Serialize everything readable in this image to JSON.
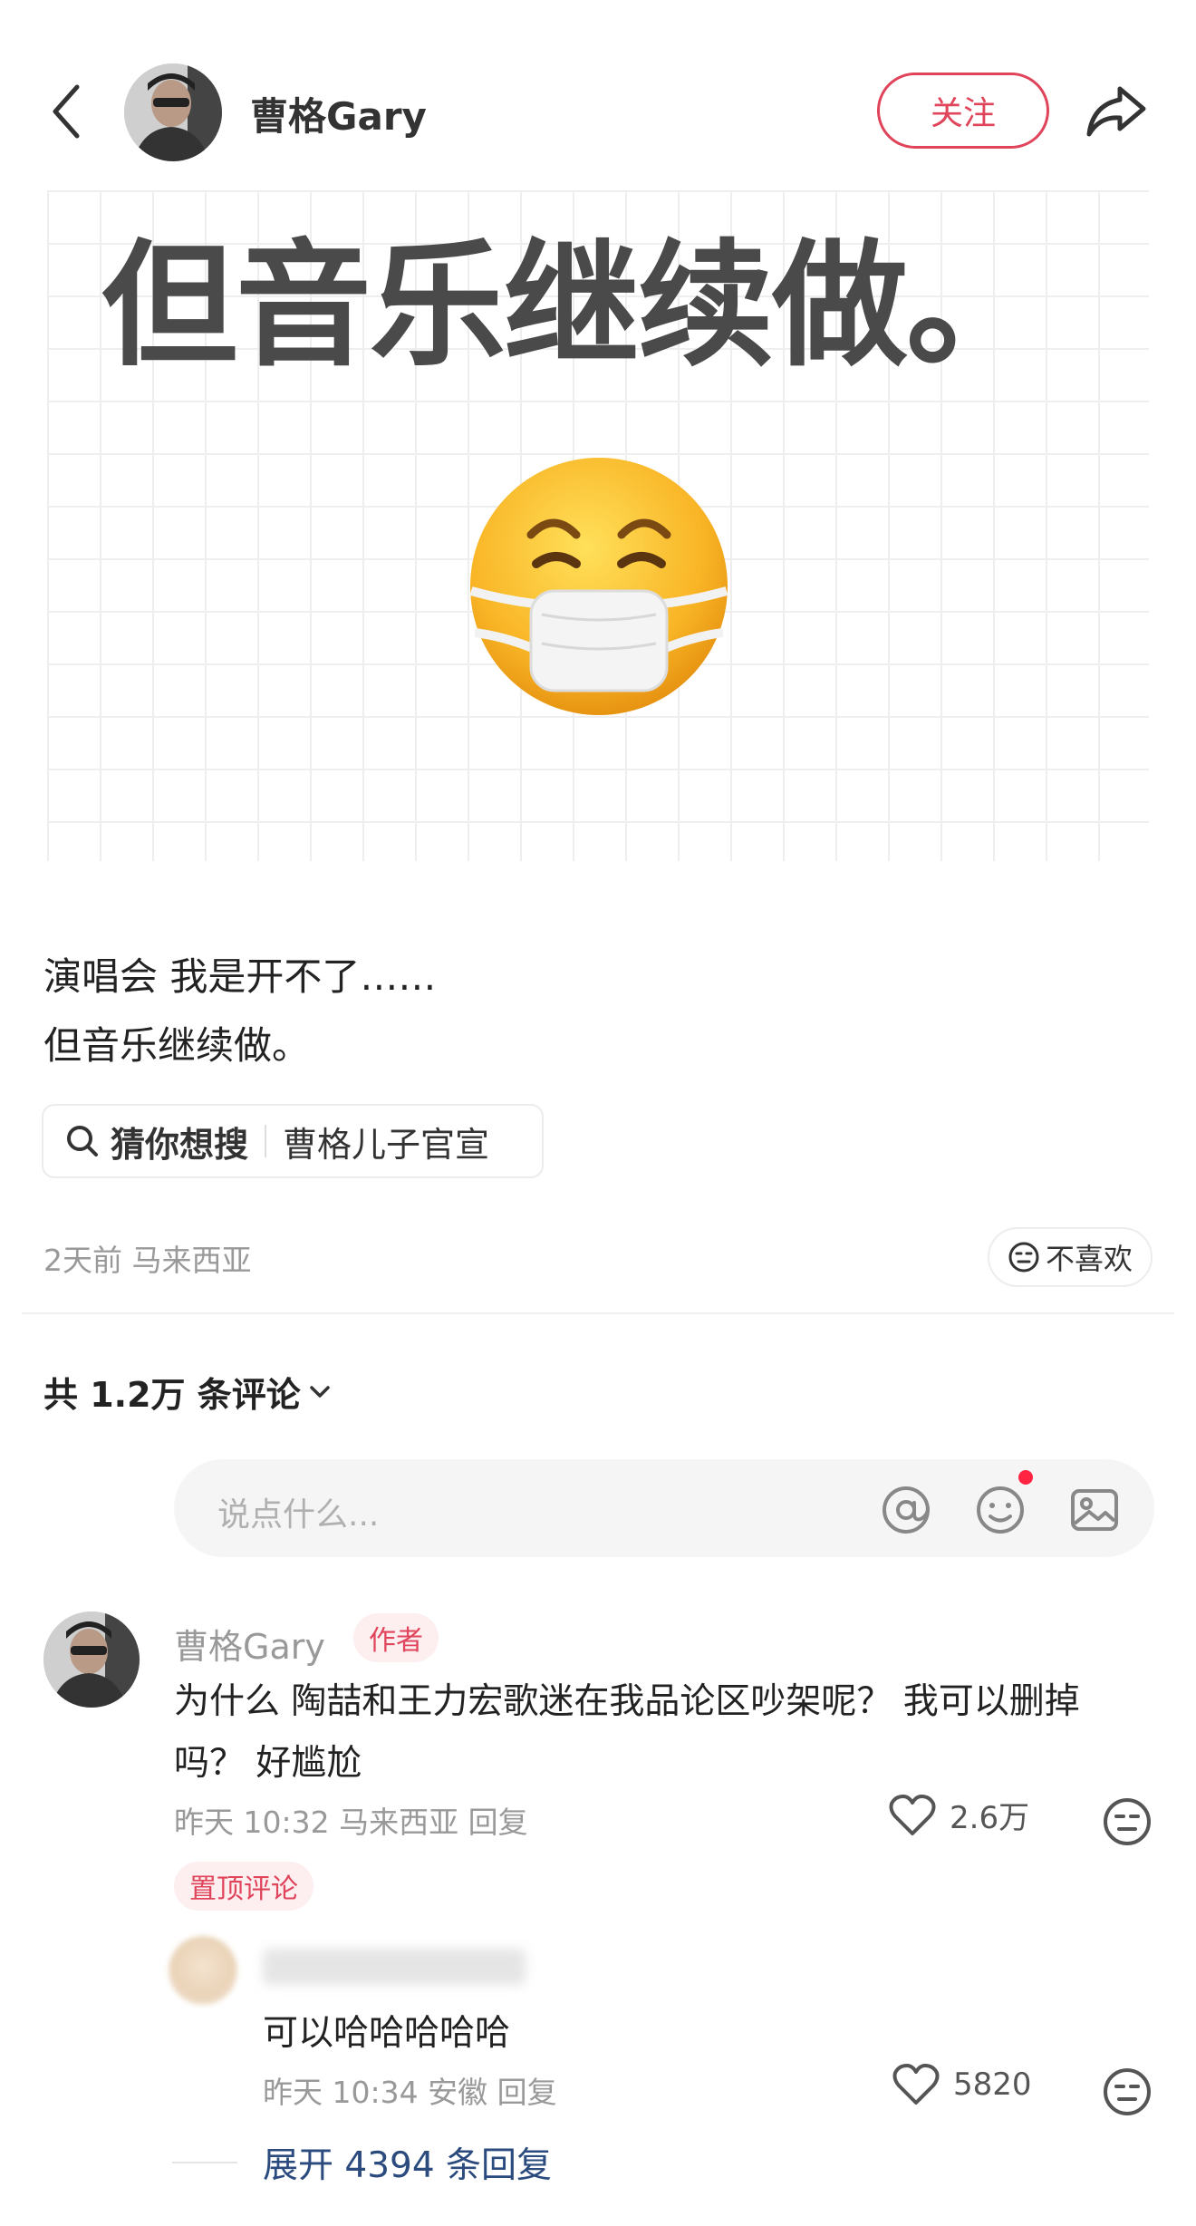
{
  "header": {
    "author_name": "曹格Gary",
    "follow_label": "关注"
  },
  "post": {
    "image_headline": "但音乐继续做。",
    "body_lines": [
      "演唱会 我是开不了……",
      "但音乐继续做。"
    ],
    "search_suggestion": {
      "label": "猜你想搜",
      "keyword": "曹格儿子官宣"
    },
    "meta": "2天前 马来西亚",
    "dislike_label": "不喜欢"
  },
  "comments_section": {
    "count_label": "共 1.2万 条评论",
    "input_placeholder": "说点什么...",
    "notification_dot_color": "#ff2442"
  },
  "comments": [
    {
      "author": "曹格Gary",
      "author_badge": "作者",
      "text_lines": [
        "为什么 陶喆和王力宏歌迷在我品论区吵架呢？ 我可以删掉",
        "吗？  好尴尬"
      ],
      "meta": "昨天 10:32 马来西亚 回复",
      "likes": "2.6万",
      "pinned_label": "置顶评论",
      "replies": [
        {
          "text": "可以哈哈哈哈哈",
          "meta": "昨天 10:34 安徽 回复",
          "likes": "5820"
        }
      ],
      "expand_label": "展开 4394 条回复"
    }
  ],
  "colors": {
    "accent": "#e0445a",
    "link": "#2b4a7e",
    "muted": "#999999"
  }
}
